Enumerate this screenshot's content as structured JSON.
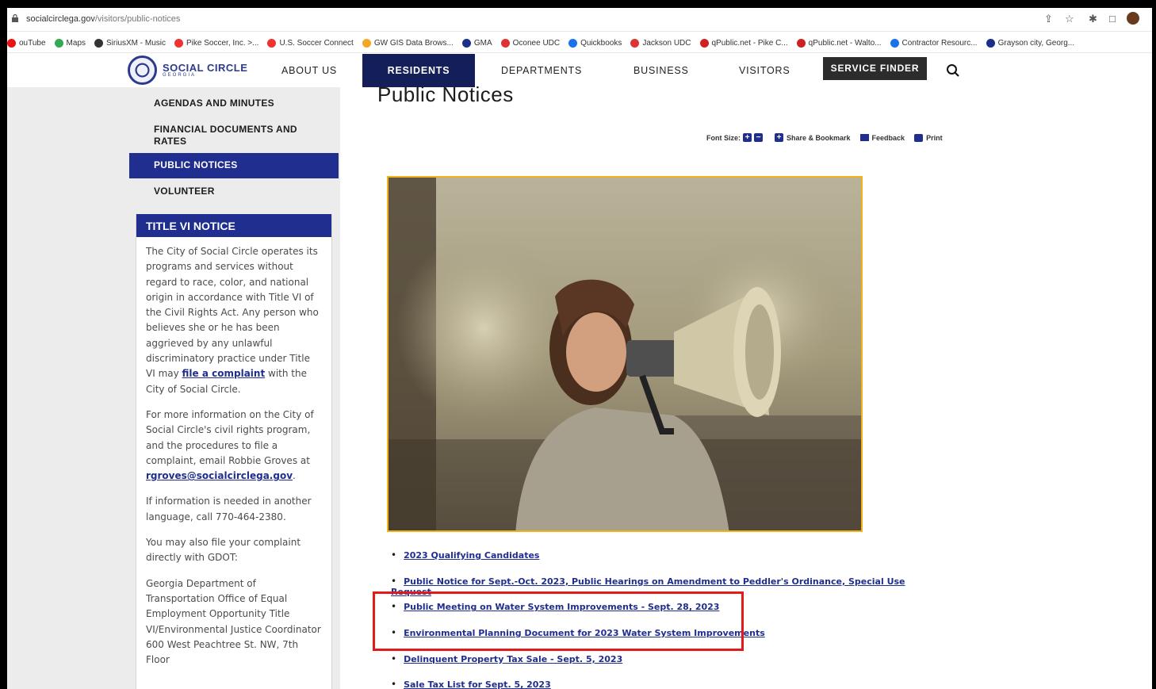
{
  "browser": {
    "url_domain": "socialcirclega.gov",
    "url_path": "/visitors/public-notices",
    "bookmarks": [
      {
        "label": "ouTube",
        "icon": "youtube-icon"
      },
      {
        "label": "Maps",
        "icon": "maps-icon"
      },
      {
        "label": "SiriusXM - Music",
        "icon": "siriusxm-icon"
      },
      {
        "label": "Pike Soccer, Inc. >...",
        "icon": "soccer-icon"
      },
      {
        "label": "U.S. Soccer Connect",
        "icon": "soccer-icon"
      },
      {
        "label": "GW GIS Data Brows...",
        "icon": "gis-icon"
      },
      {
        "label": "GMA",
        "icon": "gma-icon"
      },
      {
        "label": "Oconee UDC",
        "icon": "udc-icon"
      },
      {
        "label": "Quickbooks",
        "icon": "quickbooks-icon"
      },
      {
        "label": "Jackson UDC",
        "icon": "udc-icon"
      },
      {
        "label": "qPublic.net - Pike C...",
        "icon": "qpublic-icon"
      },
      {
        "label": "qPublic.net - Walto...",
        "icon": "qpublic-icon"
      },
      {
        "label": "Contractor Resourc...",
        "icon": "contractor-icon"
      },
      {
        "label": "Grayson city, Georg...",
        "icon": "chart-icon"
      }
    ]
  },
  "site": {
    "logo_name": "SOCIAL CIRCLE",
    "logo_sub": "GEORGIA",
    "nav": {
      "about": "ABOUT US",
      "residents": "RESIDENTS",
      "departments": "DEPARTMENTS",
      "business": "BUSINESS",
      "visitors": "VISITORS",
      "service_finder": "SERVICE FINDER"
    }
  },
  "sidebar": {
    "items": [
      "AGENDAS AND MINUTES",
      "FINANCIAL DOCUMENTS AND RATES",
      "PUBLIC NOTICES",
      "VOLUNTEER"
    ],
    "title_vi": {
      "heading": "TITLE VI NOTICE",
      "p1_before": "The City of Social Circle operates its programs and services without regard to race, color, and national origin in accordance with Title VI of the Civil Rights Act. Any person who believes she or he has been aggrieved by any unlawful discriminatory practice under Title VI may ",
      "p1_link": "file a complaint",
      "p1_after": " with the City of Social Circle.",
      "p2_before": "For more information on the City of Social Circle's civil rights program, and the procedures to file a complaint, email Robbie Groves at ",
      "p2_link": "rgroves@socialcirclega.gov",
      "p2_after": ".",
      "p3": "If information is needed in another language, call 770-464-2380.",
      "p4": "You may also file your complaint directly with GDOT:",
      "p5": "Georgia Department of Transportation Office of Equal Employment Opportunity Title VI/Environmental Justice Coordinator 600 West Peachtree St. NW, 7th Floor"
    }
  },
  "main": {
    "title": "Public Notices",
    "tools": {
      "font_size": "Font Size:",
      "share": "Share & Bookmark",
      "feedback": "Feedback",
      "print": "Print"
    },
    "links": [
      "2023 Qualifying Candidates",
      "Public Notice for Sept.-Oct. 2023, Public Hearings on Amendment to Peddler's Ordinance, Special Use Request",
      "Public Meeting on Water System Improvements - Sept. 28, 2023",
      "Environmental Planning Document for 2023 Water System Improvements",
      "Delinquent Property Tax Sale - Sept. 5, 2023",
      "Sale Tax List for Sept. 5, 2023"
    ]
  },
  "colors": {
    "nav_active": "#141f5a",
    "accent_blue": "#1f2e8f",
    "hero_border": "#f2b21a",
    "highlight_box": "#e11a1a"
  }
}
